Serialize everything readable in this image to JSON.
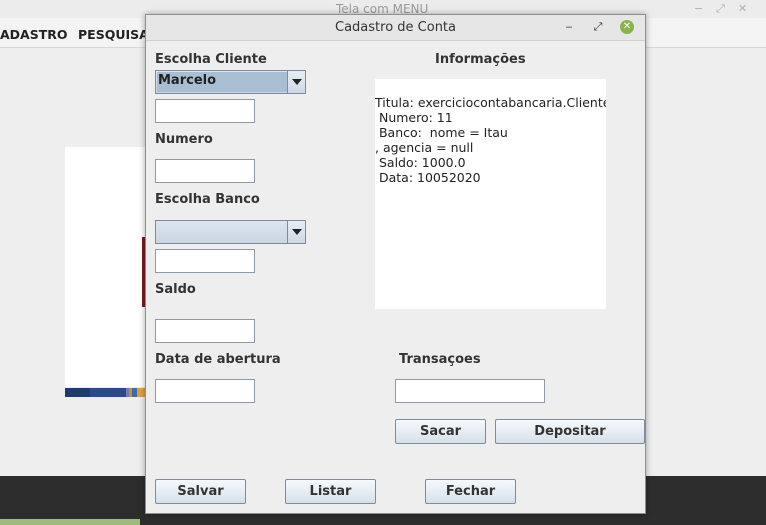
{
  "background_window": {
    "title": "Tela com MENU",
    "controls": [
      "−",
      "⤢",
      "✕"
    ],
    "menu": [
      "ADASTRO",
      "PESQUISA"
    ],
    "stripe_colors": [
      "#1d3b6b",
      "#2a4a8a",
      "#6c7fb5",
      "#d18a2a",
      "#3b6ea8",
      "#e0a040"
    ]
  },
  "dialog": {
    "title": "Cadastro de Conta",
    "controls": {
      "minimize": "‒",
      "maximize": "⤢",
      "close": "✕"
    },
    "labels": {
      "cliente": "Escolha Cliente",
      "numero": "Numero",
      "banco": "Escolha Banco",
      "saldo": "Saldo",
      "data": "Data de abertura",
      "informacoes": "Informações",
      "transacoes": "Transaçoes"
    },
    "cliente_combo": {
      "selected": "Marcelo"
    },
    "banco_combo": {
      "selected": ""
    },
    "fields": {
      "cliente_extra": "",
      "numero": "",
      "banco_extra": "",
      "saldo": "",
      "data": "",
      "transacao": ""
    },
    "info_text": "Titula: exerciciocontabancaria.Cliente\n Numero: 11\n Banco:  nome = Itau\n, agencia = null\n Saldo: 1000.0\n Data: 10052020",
    "buttons": {
      "sacar": "Sacar",
      "depositar": "Depositar",
      "salvar": "Salvar",
      "listar": "Listar",
      "fechar": "Fechar"
    },
    "colors": {
      "close_button": "#8ab34d",
      "combo_selection": "#a9bdd3"
    }
  }
}
